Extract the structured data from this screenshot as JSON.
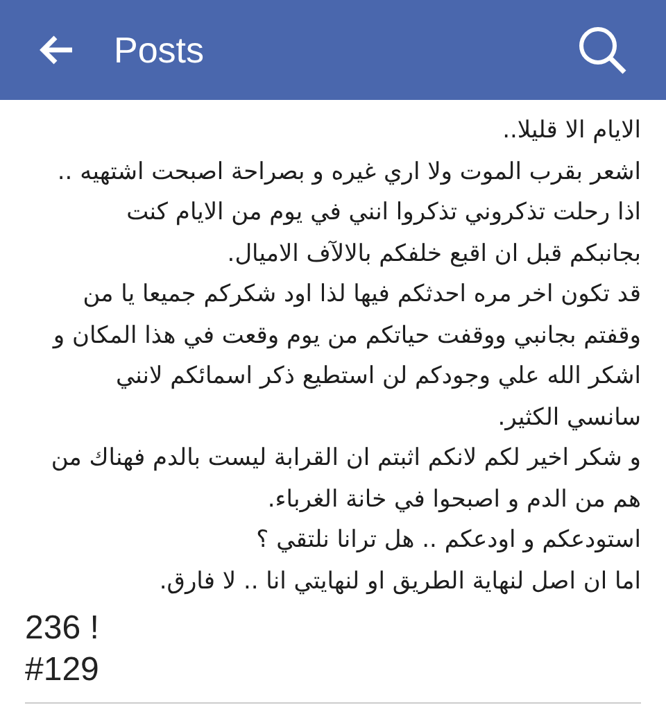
{
  "header": {
    "title": "Posts"
  },
  "post": {
    "lines": [
      "الايام الا قليلا..",
      "اشعر بقرب الموت ولا اري غيره و بصراحة اصبحت اشتهيه ..",
      "اذا رحلت تذكروني تذكروا انني في يوم من الايام كنت",
      "بجانبكم قبل ان اقبع خلفكم بالالآف الاميال.",
      "قد تكون اخر مره احدثكم فيها لذا اود شكركم جميعا يا من",
      "وقفتم بجانبي ووقفت حياتكم من يوم وقعت في هذا المكان و",
      "اشكر الله علي وجودكم لن استطيع ذكر اسمائكم لانني",
      "سانسي الكثير.",
      "و شكر اخير لكم لانكم اثبتم ان القرابة ليست بالدم فهناك من",
      "هم من الدم و اصبحوا في خانة الغرباء.",
      "استودعكم و اودعكم .. هل ترانا نلتقي ؟",
      "اما ان اصل لنهاية الطريق او لنهايتي انا .. لا فارق."
    ],
    "count": "236 !",
    "tag": "#129"
  }
}
